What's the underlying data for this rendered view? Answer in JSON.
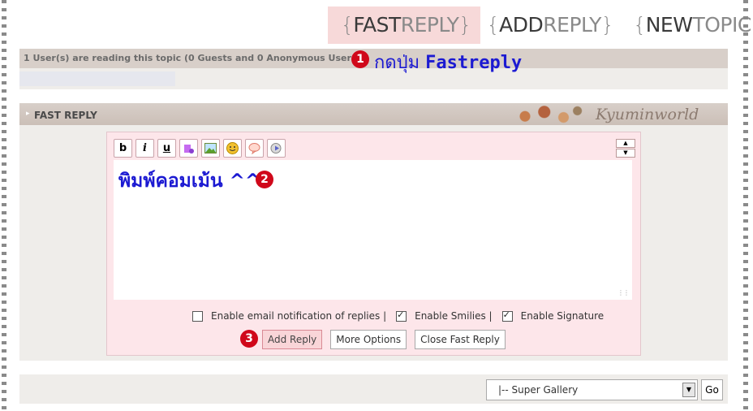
{
  "top_buttons": {
    "fastreply": {
      "dark": "FAST",
      "light": "REPLY"
    },
    "addreply": {
      "dark": "ADD",
      "light": "REPLY"
    },
    "newtopic": {
      "dark": "NEW",
      "light": "TOPIC"
    },
    "open": "{",
    "close": "}"
  },
  "readers": {
    "text": "1 User(s) are reading this topic (0 Guests and 0 Anonymous Users)"
  },
  "annotations": {
    "step1": {
      "number": "1",
      "text_thai": "กดปุ่ม",
      "text_en": "Fastreply"
    },
    "step2": {
      "number": "2"
    },
    "step3": {
      "number": "3"
    }
  },
  "fast_reply": {
    "title": "FAST REPLY",
    "brand": "Kyuminworld",
    "toolbar": [
      {
        "label": "b",
        "icon": "bold-icon"
      },
      {
        "label": "i",
        "icon": "italic-icon"
      },
      {
        "label": "u",
        "icon": "underline-icon"
      },
      {
        "label": "",
        "icon": "link-icon"
      },
      {
        "label": "",
        "icon": "image-icon"
      },
      {
        "label": "",
        "icon": "smiley-icon"
      },
      {
        "label": "",
        "icon": "quote-icon"
      },
      {
        "label": "",
        "icon": "media-icon"
      }
    ],
    "message": "พิมพ์คอมเม้น ^^",
    "options": {
      "email_label": "Enable email notification of replies |",
      "email_checked": false,
      "smilies_label": "Enable Smilies |",
      "smilies_checked": true,
      "signature_label": "Enable Signature",
      "signature_checked": true
    },
    "buttons": {
      "add_reply": "Add Reply",
      "more_options": "More Options",
      "close_fast_reply": "Close Fast Reply"
    }
  },
  "footer": {
    "forum_select": "|-- Super Gallery",
    "go_label": "Go"
  },
  "colors": {
    "annotation_blue": "#1c1ad2",
    "annotation_red": "#d0081a",
    "editor_bg": "#fde6ea"
  }
}
